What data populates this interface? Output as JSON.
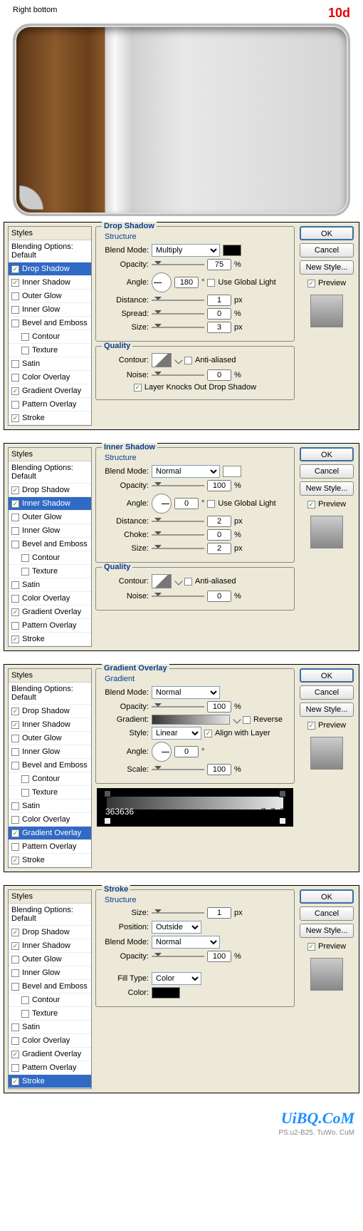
{
  "header": {
    "title": "Right bottom",
    "num": "10d"
  },
  "styles_list": {
    "header": "Styles",
    "blending": "Blending Options: Default",
    "items": [
      {
        "k": "drop",
        "l": "Drop Shadow",
        "c": true
      },
      {
        "k": "inner",
        "l": "Inner Shadow",
        "c": true
      },
      {
        "k": "oglow",
        "l": "Outer Glow",
        "c": false
      },
      {
        "k": "iglow",
        "l": "Inner Glow",
        "c": false
      },
      {
        "k": "bevel",
        "l": "Bevel and Emboss",
        "c": false
      },
      {
        "k": "contour",
        "l": "Contour",
        "c": false,
        "ind": true
      },
      {
        "k": "texture",
        "l": "Texture",
        "c": false,
        "ind": true
      },
      {
        "k": "satin",
        "l": "Satin",
        "c": false
      },
      {
        "k": "covl",
        "l": "Color Overlay",
        "c": false
      },
      {
        "k": "gradovl",
        "l": "Gradient Overlay",
        "c": true
      },
      {
        "k": "patovl",
        "l": "Pattern Overlay",
        "c": false
      },
      {
        "k": "stroke",
        "l": "Stroke",
        "c": true
      }
    ]
  },
  "buttons": {
    "ok": "OK",
    "cancel": "Cancel",
    "new": "New Style...",
    "preview": "Preview"
  },
  "labels": {
    "blend": "Blend Mode:",
    "opacity": "Opacity:",
    "angle": "Angle:",
    "distance": "Distance:",
    "spread": "Spread:",
    "size": "Size:",
    "choke": "Choke:",
    "contour": "Contour:",
    "noise": "Noise:",
    "gradient": "Gradient:",
    "style": "Style:",
    "scale": "Scale:",
    "position": "Position:",
    "filltype": "Fill Type:",
    "color": "Color:",
    "pct": "%",
    "px": "px",
    "deg": "°",
    "ugl": "Use Global Light",
    "aa": "Anti-aliased",
    "knock": "Layer Knocks Out Drop Shadow",
    "reverse": "Reverse",
    "align": "Align with Layer",
    "structure": "Structure",
    "quality": "Quality",
    "gradient_hdr": "Gradient"
  },
  "panels": [
    {
      "title": "Drop Shadow",
      "sel": "drop",
      "mode": "Multiply",
      "swatch": "#000",
      "opac": "75",
      "angle": "180",
      "dial": "a180",
      "r1l": "Distance:",
      "r1v": "1",
      "r1u": "px",
      "r2l": "Spread:",
      "r2v": "0",
      "r2u": "%",
      "r3l": "Size:",
      "r3v": "3",
      "r3u": "px",
      "quality": true,
      "knock": true,
      "noise": "0"
    },
    {
      "title": "Inner Shadow",
      "sel": "inner",
      "mode": "Normal",
      "swatch": "#fff",
      "opac": "100",
      "angle": "0",
      "dial": "a0",
      "r1l": "Distance:",
      "r1v": "2",
      "r1u": "px",
      "r2l": "Choke:",
      "r2v": "0",
      "r2u": "%",
      "r3l": "Size:",
      "r3v": "2",
      "r3u": "px",
      "quality": true,
      "noise": "0"
    }
  ],
  "grad_panel": {
    "title": "Gradient Overlay",
    "sel": "gradovl",
    "mode": "Normal",
    "opac": "100",
    "style": "Linear",
    "angle": "0",
    "scale": "100",
    "c1": "363636",
    "c2": "e7e7e7"
  },
  "stroke_panel": {
    "title": "Stroke",
    "sel": "stroke",
    "size": "1",
    "position": "Outside",
    "mode": "Normal",
    "opac": "100",
    "filltype": "Color"
  },
  "footer": {
    "logo": "UiBQ.CoM",
    "sub": "PS:u2-B25. TuWo. CuM"
  }
}
